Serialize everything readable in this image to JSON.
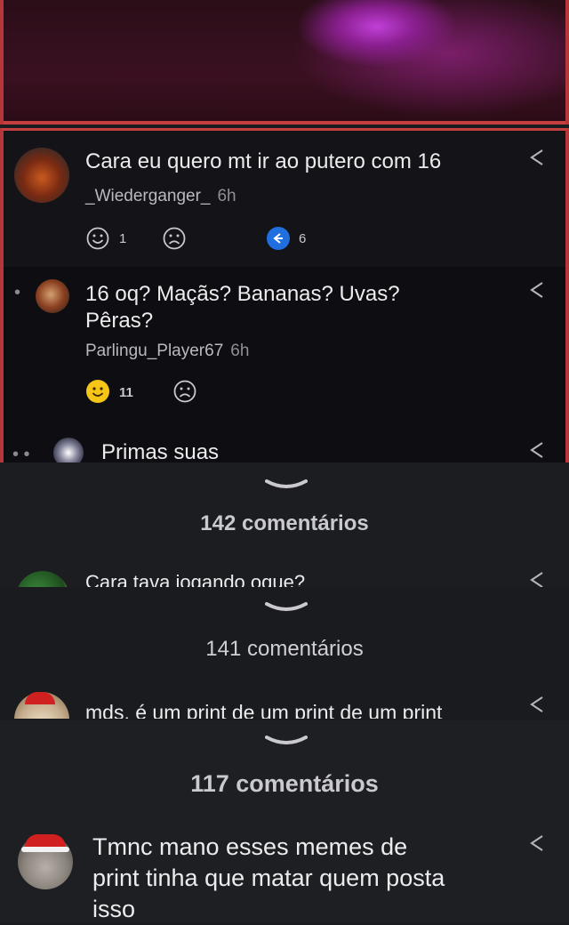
{
  "comment1": {
    "text": "Cara eu quero mt ir ao putero com 16",
    "username": "_Wiederganger_",
    "time": "6h",
    "smile_count": "1",
    "reply_count": "6"
  },
  "reply1": {
    "text_line1": "16 oq? Maçãs? Bananas? Uvas?",
    "text_line2": "Pêras?",
    "username": "Parlingu_Player67",
    "time": "6h",
    "smile_count": "11"
  },
  "reply2": {
    "text": "Primas suas"
  },
  "thread2": {
    "count_label": "142 comentários",
    "cut_comment": "Cara tava jogando oque?"
  },
  "thread3": {
    "count_label": "141 comentários",
    "cut_comment": "mds. é um print de um print de um print"
  },
  "thread4": {
    "count_label": "117 comentários",
    "text_line1": "Tmnc mano esses memes de",
    "text_line2": "print tinha que matar quem posta",
    "text_line3": "isso"
  },
  "icons": {
    "share": "share-icon",
    "smile": "smile-icon",
    "frown": "frown-icon",
    "reply": "reply-icon",
    "chevron": "chevron-down-icon"
  },
  "colors": {
    "accent_border": "#c4403f",
    "reply_blue": "#1f6fe0",
    "smile_yellow": "#f5c518"
  }
}
